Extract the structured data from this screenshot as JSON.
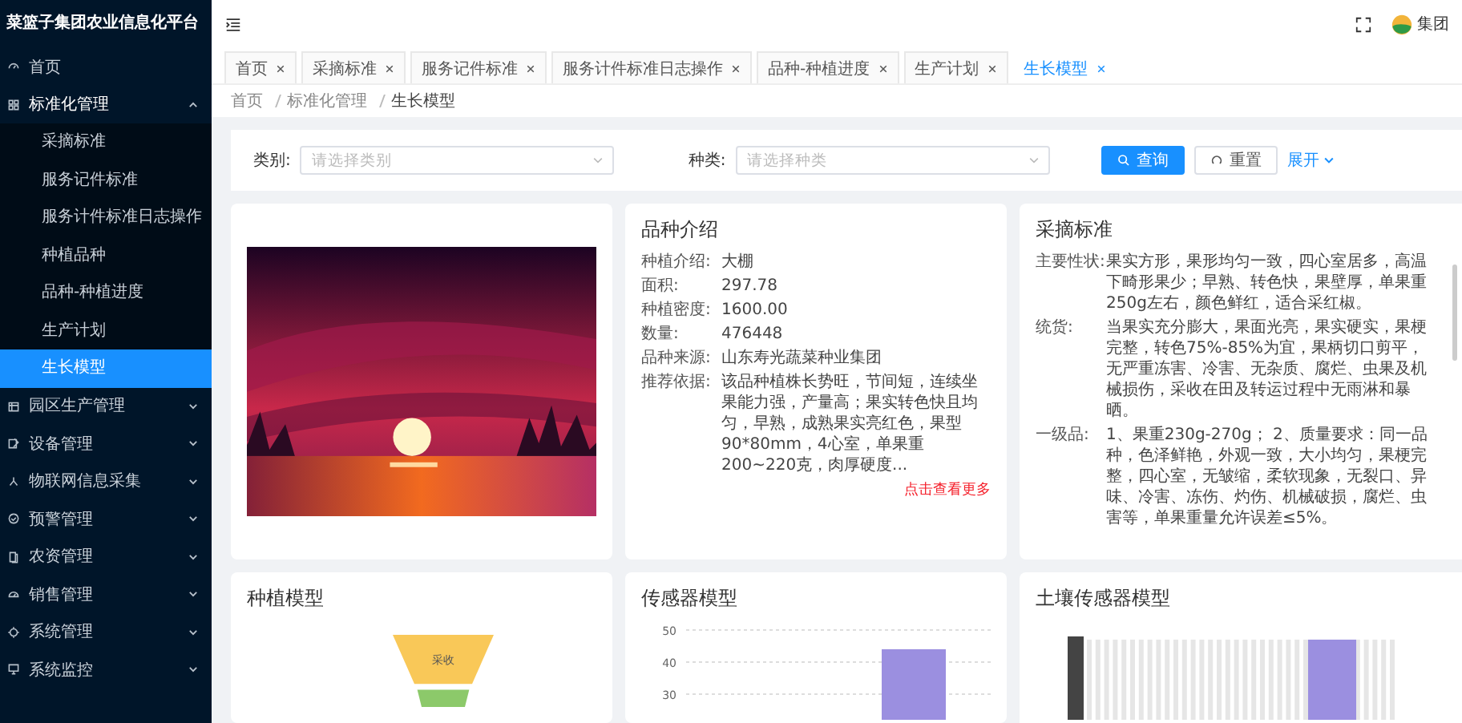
{
  "sidebar": {
    "title": "菜篮子集团农业信息化平台",
    "items": [
      {
        "label": "首页"
      },
      {
        "label": "标准化管理",
        "expanded": true,
        "children": [
          {
            "label": "采摘标准",
            "selected": false
          },
          {
            "label": "服务记件标准",
            "selected": false
          },
          {
            "label": "服务计件标准日志操作",
            "selected": false
          },
          {
            "label": "种植品种",
            "selected": false
          },
          {
            "label": "品种-种植进度",
            "selected": false
          },
          {
            "label": "生产计划",
            "selected": false
          },
          {
            "label": "生长模型",
            "selected": true
          }
        ]
      },
      {
        "label": "园区生产管理",
        "expanded": false
      },
      {
        "label": "设备管理",
        "expanded": false
      },
      {
        "label": "物联网信息采集",
        "expanded": false
      },
      {
        "label": "预警管理",
        "expanded": false
      },
      {
        "label": "农资管理",
        "expanded": false
      },
      {
        "label": "销售管理",
        "expanded": false
      },
      {
        "label": "系统管理",
        "expanded": false
      },
      {
        "label": "系统监控",
        "expanded": false
      }
    ]
  },
  "header": {
    "user": "集团"
  },
  "tabs": [
    {
      "label": "首页",
      "selected": false
    },
    {
      "label": "采摘标准",
      "selected": false
    },
    {
      "label": "服务记件标准",
      "selected": false
    },
    {
      "label": "服务计件标准日志操作",
      "selected": false
    },
    {
      "label": "品种-种植进度",
      "selected": false
    },
    {
      "label": "生产计划",
      "selected": false
    },
    {
      "label": "生长模型",
      "selected": true
    }
  ],
  "breadcrumb": [
    "首页",
    "标准化管理",
    "生长模型"
  ],
  "filter": {
    "fields": [
      {
        "label": "类别:",
        "placeholder": "请选择类别"
      },
      {
        "label": "种类:",
        "placeholder": "请选择种类"
      }
    ],
    "search": "查询",
    "reset": "重置",
    "expand": "展开"
  },
  "variety": {
    "title": "品种介绍",
    "rows": [
      {
        "label": "种植介绍:",
        "value": "大棚"
      },
      {
        "label": "面积:",
        "value": "297.78"
      },
      {
        "label": "种植密度:",
        "value": "1600.00"
      },
      {
        "label": "数量:",
        "value": "476448"
      },
      {
        "label": "品种来源:",
        "value": "山东寿光蔬菜种业集团"
      },
      {
        "label": "推荐依据:",
        "value": "该品种植株长势旺，节间短，连续坐果能力强，产量高；果实转色快且均匀，早熟，成熟果实亮红色，果型90*80mm，4心室，单果重200~220克，肉厚硬度..."
      }
    ],
    "more": "点击查看更多"
  },
  "picking": {
    "title": "采摘标准",
    "rows": [
      {
        "label": "主要性状:",
        "value": "果实方形，果形均匀一致，四心室居多，高温下畸形果少；早熟、转色快，果壁厚，单果重250g左右，颜色鲜红，适合采红椒。"
      },
      {
        "label": "统货:",
        "value": "当果实充分膨大，果面光亮，果实硬实，果梗完整，转色75%-85%为宜，果柄切口剪平，无严重冻害、冷害、无杂质、腐烂、虫果及机械损伤，采收在田及转运过程中无雨淋和暴晒。"
      },
      {
        "label": "一级品:",
        "value": "1、果重230g-270g； 2、质量要求：同一品种，色泽鲜艳，外观一致，大小均匀，果梗完整，四心室，无皱缩，柔软现象，无裂口、异味、冷害、冻伤、灼伤、机械破损，腐烂、虫害等，单果重量允许误差≤5%。"
      }
    ]
  },
  "planting": {
    "title": "种植模型",
    "funnel_label": "采收"
  },
  "sensor": {
    "title": "传感器模型",
    "chart_data": {
      "type": "bar",
      "values": [
        44
      ],
      "yticks": [
        30,
        40,
        50
      ],
      "ylim": [
        0,
        50
      ]
    }
  },
  "soil": {
    "title": "土壤传感器模型"
  }
}
